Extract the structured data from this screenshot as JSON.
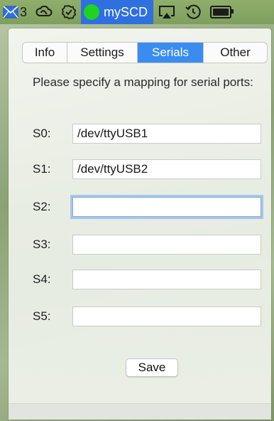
{
  "menubar": {
    "mail_count": "3",
    "active_app": "mySCD",
    "icons": [
      "mail-icon",
      "creative-cloud-icon",
      "checkmark-badge-icon",
      "airplay-icon",
      "time-machine-icon",
      "battery-icon"
    ]
  },
  "tabs": [
    {
      "label": "Info",
      "active": false
    },
    {
      "label": "Settings",
      "active": false
    },
    {
      "label": "Serials",
      "active": true
    },
    {
      "label": "Other",
      "active": false
    }
  ],
  "description": "Please specify a mapping for serial ports:",
  "serials": [
    {
      "label": "S0:",
      "value": "/dev/ttyUSB1"
    },
    {
      "label": "S1:",
      "value": "/dev/ttyUSB2"
    },
    {
      "label": "S2:",
      "value": ""
    },
    {
      "label": "S3:",
      "value": ""
    },
    {
      "label": "S4:",
      "value": ""
    },
    {
      "label": "S5:",
      "value": ""
    }
  ],
  "save_label": "Save",
  "colors": {
    "accent": "#3a8cf0",
    "status_green": "#21d321"
  }
}
